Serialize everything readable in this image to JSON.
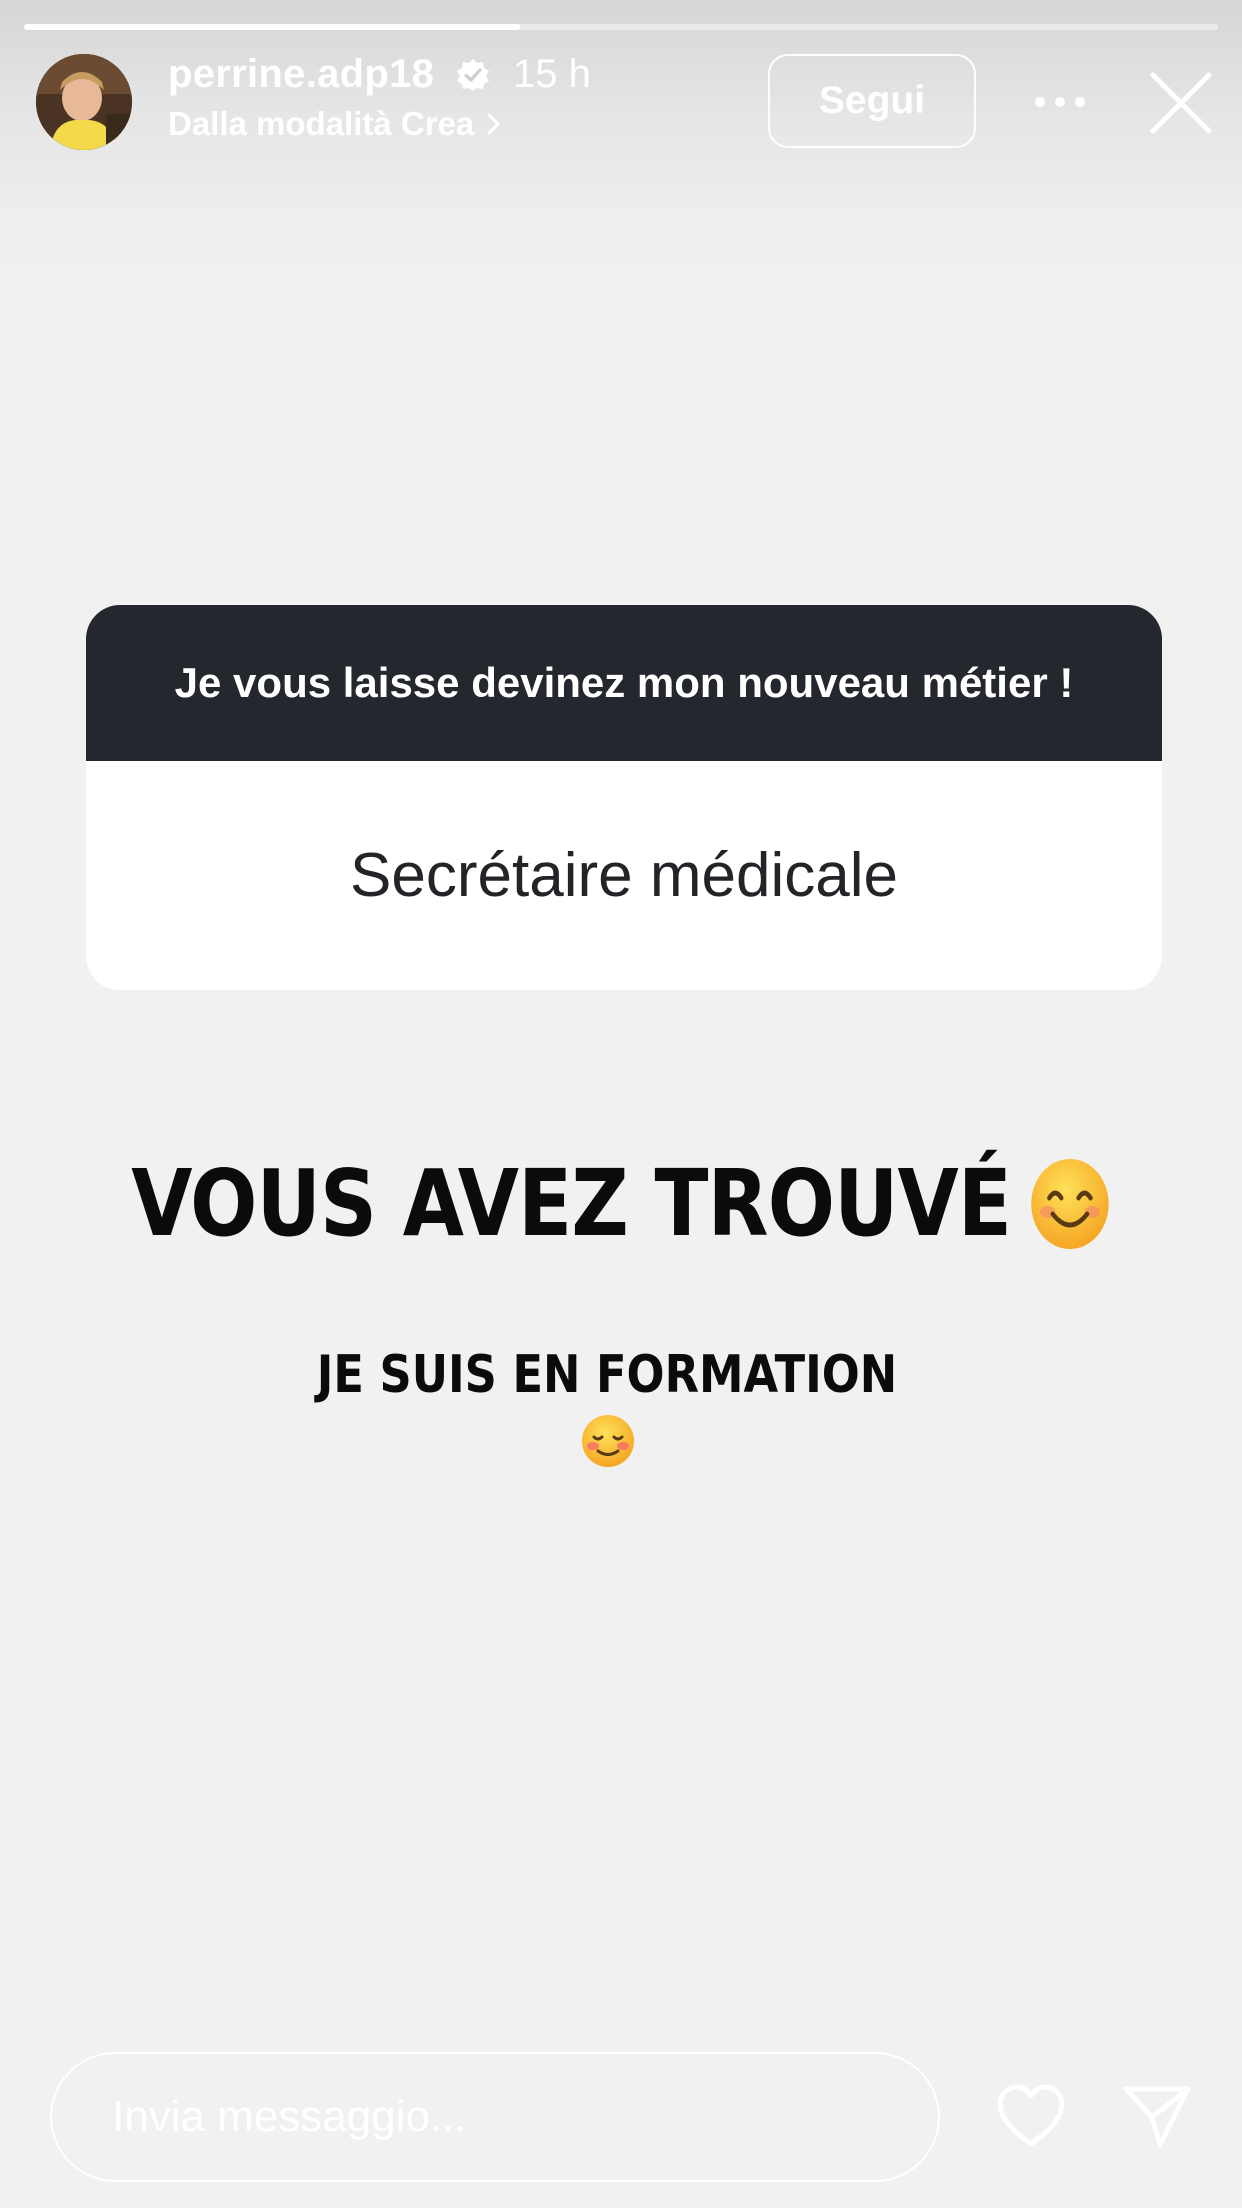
{
  "story": {
    "progress_fraction": 0.415
  },
  "header": {
    "username": "perrine.adp18",
    "timestamp": "15 h",
    "subtitle": "Dalla modalità Crea",
    "follow_label": "Segui",
    "icons": {
      "verified": "verified-badge-icon",
      "more": "more-options-icon",
      "close": "close-icon",
      "chevron": "chevron-right-icon"
    }
  },
  "question_sticker": {
    "question": "Je vous laisse devinez mon nouveau métier !",
    "answer": "Secrétaire médicale"
  },
  "text": {
    "headline": "VOUS AVEZ TROUVÉ",
    "subline": "JE SUIS EN FORMATION"
  },
  "footer": {
    "message_placeholder": "Invia messaggio...",
    "icons": {
      "like": "heart-icon",
      "share": "send-icon"
    }
  },
  "colors": {
    "sticker_header": "#24272d",
    "background": "#f1f1f1"
  }
}
